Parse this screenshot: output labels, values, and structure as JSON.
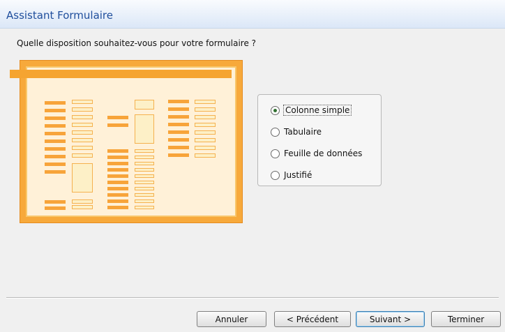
{
  "window": {
    "title": "Assistant Formulaire"
  },
  "main": {
    "prompt": "Quelle disposition souhaitez-vous pour votre formulaire ?"
  },
  "layout_options": [
    {
      "label": "Colonne simple",
      "selected": true
    },
    {
      "label": "Tabulaire",
      "selected": false
    },
    {
      "label": "Feuille de données",
      "selected": false
    },
    {
      "label": "Justifié",
      "selected": false
    }
  ],
  "buttons": {
    "cancel": "Annuler",
    "previous": "< Précédent",
    "next": "Suivant >",
    "finish": "Terminer"
  },
  "colors": {
    "title": "#1f4e9c",
    "preview_orange": "#f7a93b",
    "preview_light": "#fdf0c7"
  }
}
